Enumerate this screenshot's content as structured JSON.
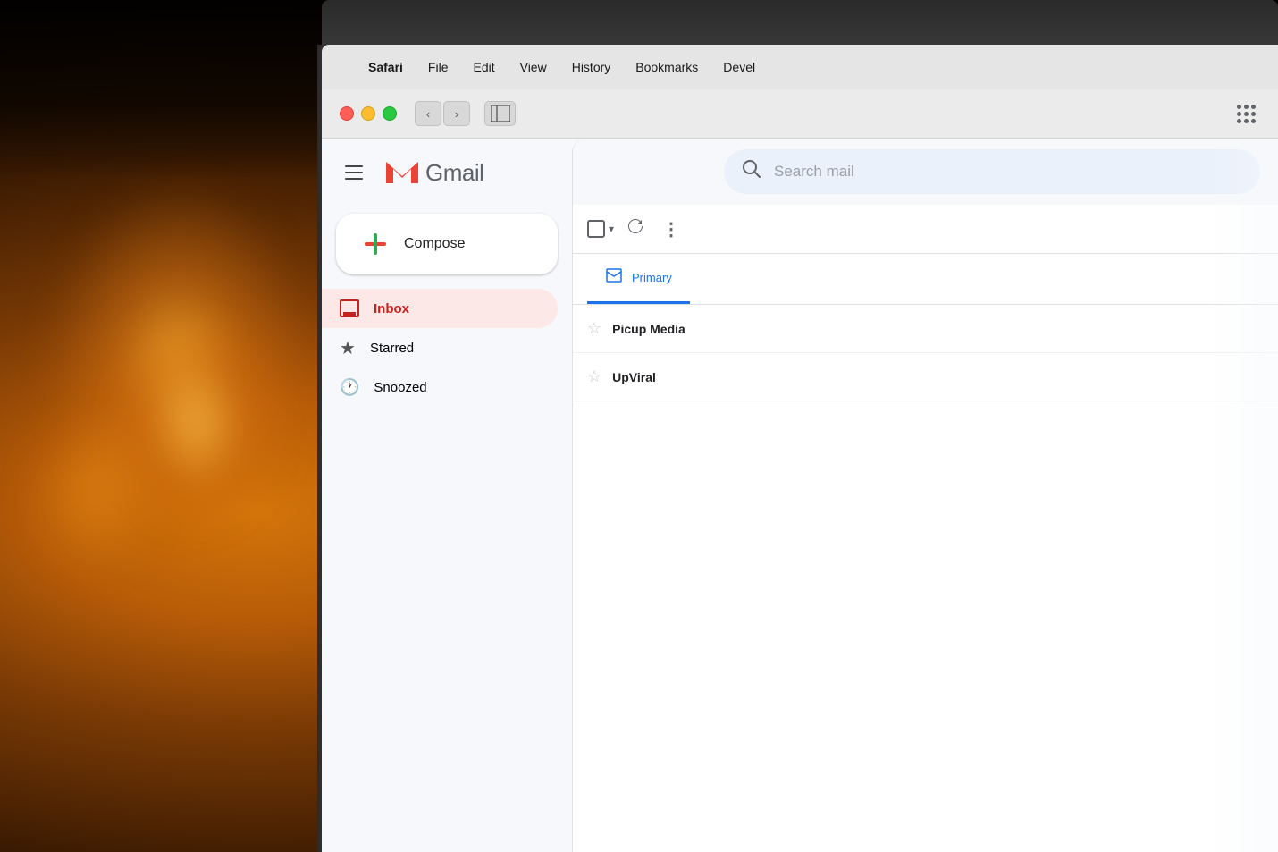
{
  "background": {
    "description": "Warm bokeh background with orange/amber lights"
  },
  "mac_menubar": {
    "apple_symbol": "",
    "items": [
      {
        "id": "safari",
        "label": "Safari",
        "bold": true
      },
      {
        "id": "file",
        "label": "File",
        "bold": false
      },
      {
        "id": "edit",
        "label": "Edit",
        "bold": false
      },
      {
        "id": "view",
        "label": "View",
        "bold": false
      },
      {
        "id": "history",
        "label": "History",
        "bold": false
      },
      {
        "id": "bookmarks",
        "label": "Bookmarks",
        "bold": false
      },
      {
        "id": "develop",
        "label": "Devel",
        "bold": false
      }
    ]
  },
  "browser": {
    "nav": {
      "back_label": "‹",
      "forward_label": "›"
    }
  },
  "gmail": {
    "hamburger_label": "☰",
    "logo_m": "M",
    "logo_text": "Gmail",
    "search_placeholder": "Search mail",
    "compose_label": "Compose",
    "nav_items": [
      {
        "id": "inbox",
        "label": "Inbox",
        "active": true
      },
      {
        "id": "starred",
        "label": "Starred",
        "active": false
      },
      {
        "id": "snoozed",
        "label": "Snoozed",
        "active": false
      }
    ],
    "tabs": [
      {
        "id": "primary",
        "label": "Primary",
        "active": true
      }
    ],
    "email_rows": [
      {
        "id": "row1",
        "sender": "Picup Media",
        "preview": ""
      },
      {
        "id": "row2",
        "sender": "UpViral",
        "preview": ""
      }
    ]
  },
  "toolbar": {
    "more_label": "⋮"
  }
}
